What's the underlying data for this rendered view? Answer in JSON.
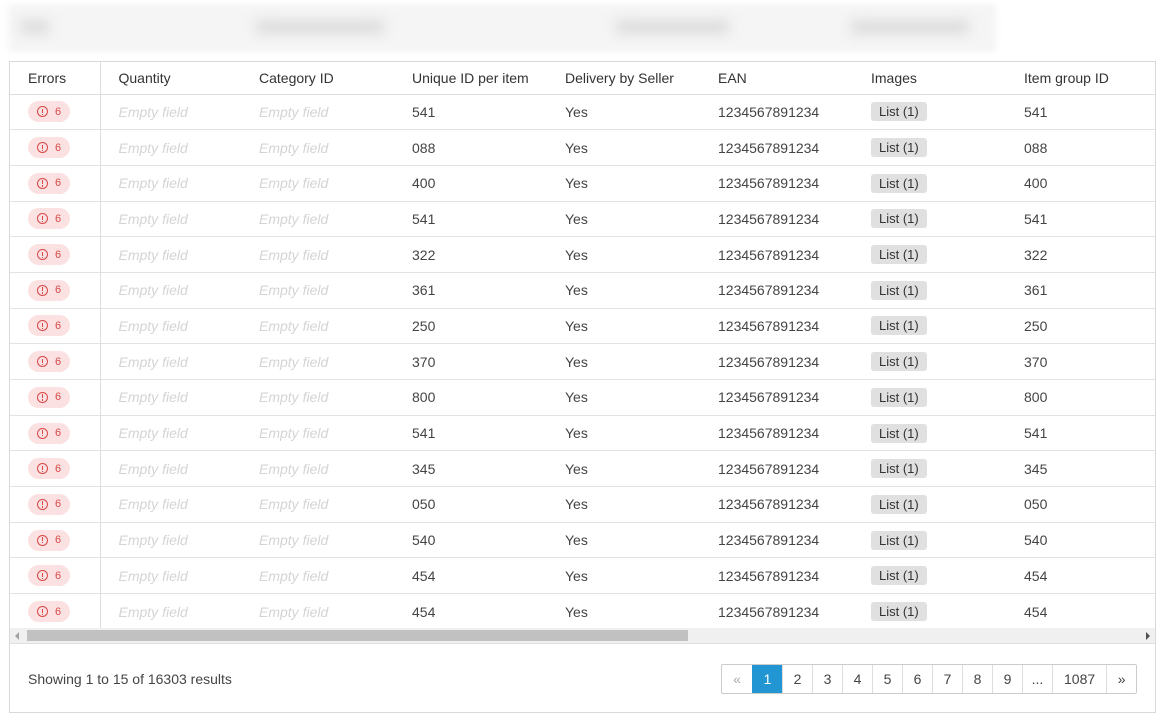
{
  "columns": [
    "Errors",
    "Quantity",
    "Category ID",
    "Unique ID per item",
    "Delivery by Seller",
    "EAN",
    "Images",
    "Item group ID"
  ],
  "empty_label": "Empty field",
  "rows": [
    {
      "errors": "6",
      "unique_id": "541",
      "delivery": "Yes",
      "ean": "1234567891234",
      "images": "List (1)",
      "group_id": "541"
    },
    {
      "errors": "6",
      "unique_id": "088",
      "delivery": "Yes",
      "ean": "1234567891234",
      "images": "List (1)",
      "group_id": "088"
    },
    {
      "errors": "6",
      "unique_id": "400",
      "delivery": "Yes",
      "ean": "1234567891234",
      "images": "List (1)",
      "group_id": "400"
    },
    {
      "errors": "6",
      "unique_id": "541",
      "delivery": "Yes",
      "ean": "1234567891234",
      "images": "List (1)",
      "group_id": "541"
    },
    {
      "errors": "6",
      "unique_id": "322",
      "delivery": "Yes",
      "ean": "1234567891234",
      "images": "List (1)",
      "group_id": "322"
    },
    {
      "errors": "6",
      "unique_id": "361",
      "delivery": "Yes",
      "ean": "1234567891234",
      "images": "List (1)",
      "group_id": "361"
    },
    {
      "errors": "6",
      "unique_id": "250",
      "delivery": "Yes",
      "ean": "1234567891234",
      "images": "List (1)",
      "group_id": "250"
    },
    {
      "errors": "6",
      "unique_id": "370",
      "delivery": "Yes",
      "ean": "1234567891234",
      "images": "List (1)",
      "group_id": "370"
    },
    {
      "errors": "6",
      "unique_id": "800",
      "delivery": "Yes",
      "ean": "1234567891234",
      "images": "List (1)",
      "group_id": "800"
    },
    {
      "errors": "6",
      "unique_id": "541",
      "delivery": "Yes",
      "ean": "1234567891234",
      "images": "List (1)",
      "group_id": "541"
    },
    {
      "errors": "6",
      "unique_id": "345",
      "delivery": "Yes",
      "ean": "1234567891234",
      "images": "List (1)",
      "group_id": "345"
    },
    {
      "errors": "6",
      "unique_id": "050",
      "delivery": "Yes",
      "ean": "1234567891234",
      "images": "List (1)",
      "group_id": "050"
    },
    {
      "errors": "6",
      "unique_id": "540",
      "delivery": "Yes",
      "ean": "1234567891234",
      "images": "List (1)",
      "group_id": "540"
    },
    {
      "errors": "6",
      "unique_id": "454",
      "delivery": "Yes",
      "ean": "1234567891234",
      "images": "List (1)",
      "group_id": "454"
    },
    {
      "errors": "6",
      "unique_id": "454",
      "delivery": "Yes",
      "ean": "1234567891234",
      "images": "List (1)",
      "group_id": "454"
    }
  ],
  "footer": {
    "showing_text": "Showing 1 to 15 of 16303 results"
  },
  "pagination": {
    "prev": "«",
    "pages": [
      "1",
      "2",
      "3",
      "4",
      "5",
      "6",
      "7",
      "8",
      "9",
      "...",
      "1087"
    ],
    "next": "»",
    "active": "1"
  },
  "colors": {
    "active_page": "#2196d3",
    "error_badge_bg": "#fbe1e1",
    "error_badge_text": "#d84848",
    "empty_text": "#d4d4d4"
  },
  "icons": {
    "error_badge": "alert-circle-icon",
    "scroll_left": "arrow-left-icon",
    "scroll_right": "arrow-right-icon"
  }
}
